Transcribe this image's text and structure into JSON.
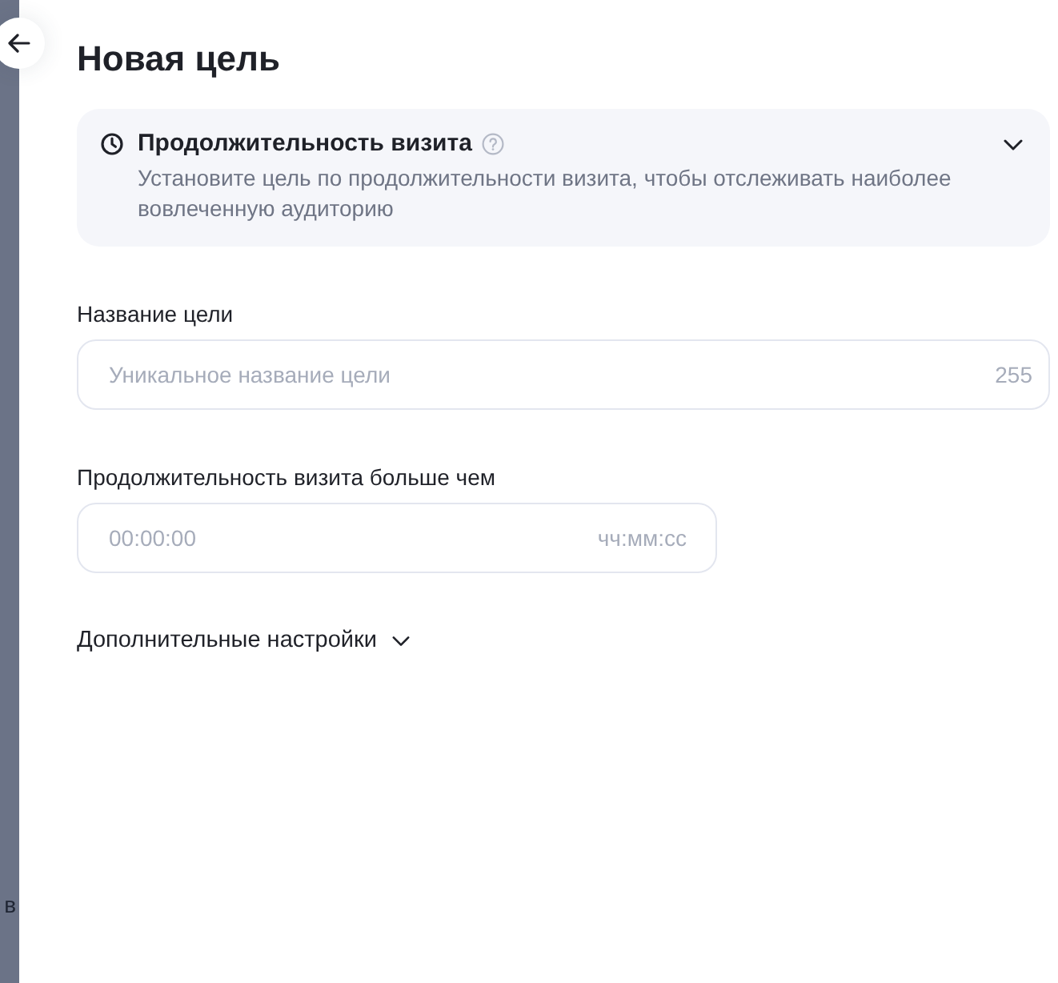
{
  "backdrop": {
    "text": "в"
  },
  "title": "Новая цель",
  "goal_type": {
    "title": "Продолжительность визита",
    "description": "Установите цель по продолжительности визита, чтобы отслеживать наиболее вовлеченную аудиторию",
    "expanded": false
  },
  "fields": [
    {
      "kind": "text",
      "label": "Название цели",
      "placeholder": "Уникальное название цели",
      "counter": "255"
    },
    {
      "kind": "duration",
      "label": "Продолжительность визита больше чем",
      "placeholder": "00:00:00",
      "format_hint": "чч:мм:сс"
    }
  ],
  "advanced_settings": {
    "label": "Дополнительные настройки",
    "expanded": false
  }
}
